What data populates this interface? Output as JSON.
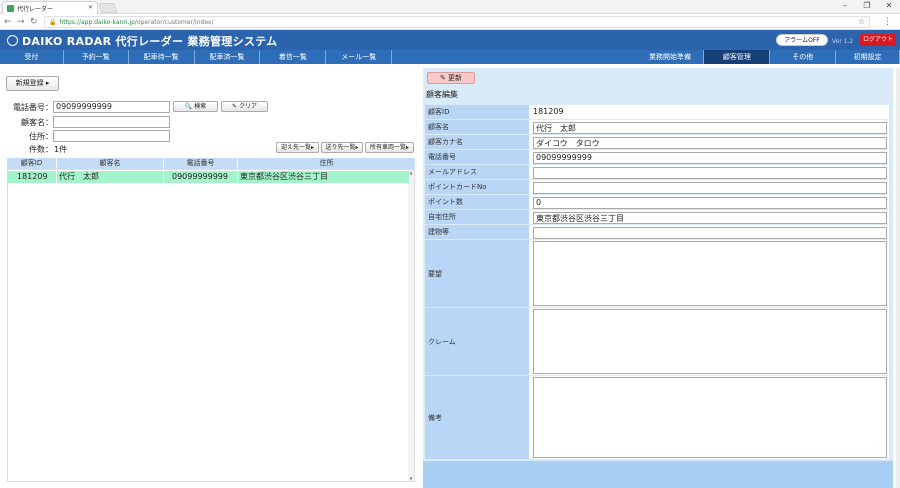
{
  "browser": {
    "tab_title": "代行レーダー",
    "url_host": "https://app.daiko-kanri.jp",
    "url_path": "/operator/customer/index/"
  },
  "header": {
    "brand": "DAIKO RADAR 代行レーダー 業務管理システム",
    "alarm_label": "アラームOFF",
    "version": "Ver 1.2",
    "logout_label": "ログアウト",
    "nav_items": [
      {
        "label": "受付"
      },
      {
        "label": "予約一覧"
      },
      {
        "label": "配車待一覧"
      },
      {
        "label": "配車済一覧"
      },
      {
        "label": "着信一覧"
      },
      {
        "label": "メール一覧"
      }
    ],
    "nav_right_items": [
      {
        "label": "業務開始準備"
      },
      {
        "label": "顧客管理",
        "active": true
      },
      {
        "label": "その他"
      },
      {
        "label": "初期設定"
      }
    ]
  },
  "left": {
    "new_register": "新規登録",
    "phone_label": "電話番号：",
    "phone_value": "09099999999",
    "search_button": "検索",
    "clear_button": "クリア",
    "name_label": "顧客名：",
    "name_value": "",
    "address_label": "住所：",
    "address_value": "",
    "count_label": "件数：",
    "count_value": "1件",
    "btn_pickup_list": "迎え先一覧",
    "btn_dropoff_list": "送り先一覧",
    "btn_vehicle_list": "所有車両一覧",
    "columns": [
      "顧客ID",
      "顧客名",
      "電話番号",
      "住所"
    ],
    "rows": [
      {
        "id": "181209",
        "name": "代行　太郎",
        "phone": "09099999999",
        "address": "東京都渋谷区渋谷三丁目"
      }
    ]
  },
  "right": {
    "refresh_button": "更新",
    "title": "顧客編集",
    "fields": {
      "customer_id_label": "顧客ID",
      "customer_id_value": "181209",
      "name_label": "顧客名",
      "name_value": "代行　太郎",
      "kana_label": "顧客カナ名",
      "kana_value": "ダイコウ　タロウ",
      "phone_label": "電話番号",
      "phone_value": "09099999999",
      "email_label": "メールアドレス",
      "email_value": "",
      "pointcard_label": "ポイントカードNo",
      "pointcard_value": "",
      "points_label": "ポイント数",
      "points_value": "0",
      "home_label": "自宅住所",
      "home_value": "東京都渋谷区渋谷三丁目",
      "building_label": "建物等",
      "building_value": "",
      "request_label": "要望",
      "request_value": "",
      "claim_label": "クレーム",
      "claim_value": "",
      "notes_label": "備考",
      "notes_value": ""
    }
  }
}
